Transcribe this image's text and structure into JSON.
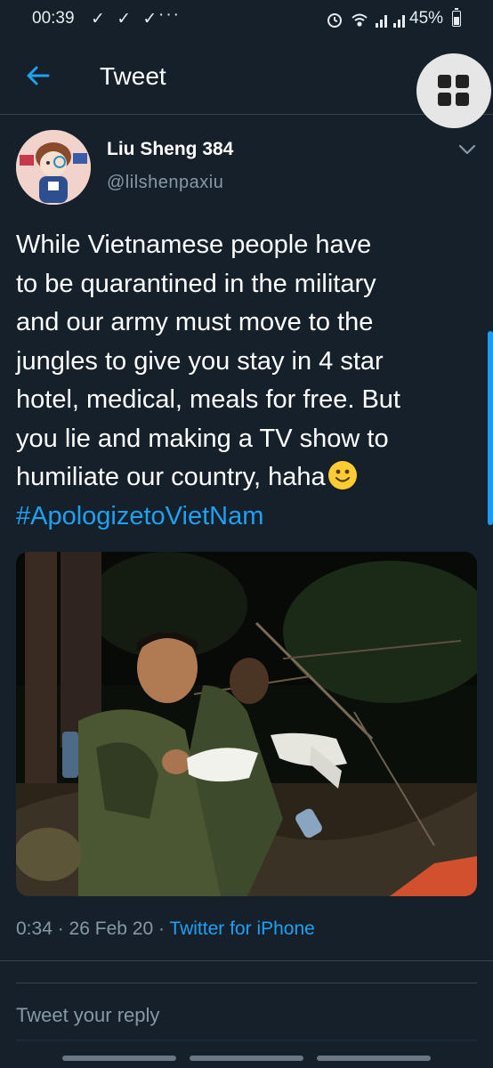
{
  "status_bar": {
    "time": "00:39",
    "notification_icons": "✓ ✓ ✓",
    "overflow_dots": "···",
    "battery_percent": "45%",
    "battery_level": 0.45
  },
  "header": {
    "title": "Tweet"
  },
  "tweet": {
    "author_name": "Liu Sheng 384",
    "author_handle": "@lilshenpaxiu",
    "text": "While Vietnamese people have\nto be quarantined in the military\nand our army must move to the\njungles to give you stay in 4 star\nhotel, medical, meals for free. But\nyou lie and making a TV show to\nhumiliate our country, haha",
    "emoji": "slightly-smiling-face",
    "hashtag": "#ApologizetoVietNam",
    "time": "0:34",
    "date": "26 Feb 20",
    "source": "Twitter for iPhone",
    "separator": " · "
  },
  "reply": {
    "placeholder": "Tweet your reply"
  },
  "colors": {
    "background": "#15202b",
    "accent": "#1da1f2",
    "secondary_text": "#8899a6",
    "divider": "#38444d"
  },
  "icons": {
    "back": "arrow-left-icon",
    "grid": "grid-icon",
    "caret": "chevron-down-icon"
  }
}
